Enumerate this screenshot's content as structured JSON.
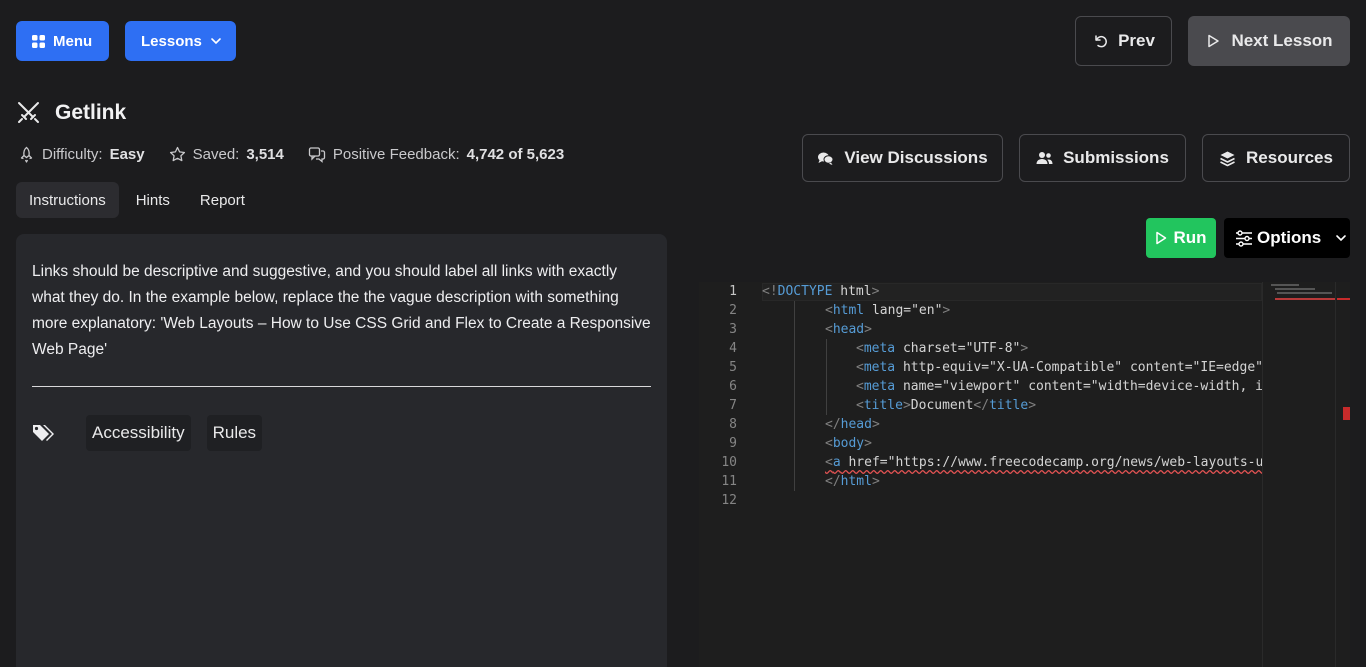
{
  "header": {
    "menu_label": "Menu",
    "lessons_label": "Lessons",
    "prev_label": "Prev",
    "next_label": "Next Lesson"
  },
  "lesson": {
    "title": "Getlink",
    "difficulty_label": "Difficulty:",
    "difficulty_value": "Easy",
    "saved_label": "Saved:",
    "saved_value": "3,514",
    "feedback_label": "Positive Feedback:",
    "feedback_value": "4,742 of 5,623"
  },
  "actions": {
    "discussions_label": "View Discussions",
    "submissions_label": "Submissions",
    "resources_label": "Resources",
    "run_label": "Run",
    "options_label": "Options"
  },
  "tabs": [
    {
      "label": "Instructions",
      "active": true
    },
    {
      "label": "Hints",
      "active": false
    },
    {
      "label": "Report",
      "active": false
    }
  ],
  "instructions": {
    "text": "Links should be descriptive and suggestive, and you should label all links with exactly what they do. In the example below, replace the the vague description with something more explanatory: 'Web Layouts – How to Use CSS Grid and Flex to Create a Responsive Web Page'",
    "tags": [
      "Accessibility",
      "Rules"
    ]
  },
  "editor": {
    "line_numbers": [
      "1",
      "2",
      "3",
      "4",
      "5",
      "6",
      "7",
      "8",
      "9",
      "10",
      "11",
      "12"
    ],
    "current_line": 1,
    "lines": [
      "<!DOCTYPE html>",
      "<html lang=\"en\">",
      "<head>",
      "<meta charset=\"UTF-8\">",
      "<meta http-equiv=\"X-UA-Compatible\" content=\"IE=edge\">",
      "<meta name=\"viewport\" content=\"width=device-width, in",
      "<title>Document</title>",
      "</head>",
      "<body>",
      "<a href=\"https://www.freecodecamp.org/news/web-layouts-us",
      "</html>",
      ""
    ]
  },
  "colors": {
    "primary_blue": "#2e6ff3",
    "run_green": "#22c55e",
    "background": "#1c1c1e",
    "panel": "#27282c"
  }
}
